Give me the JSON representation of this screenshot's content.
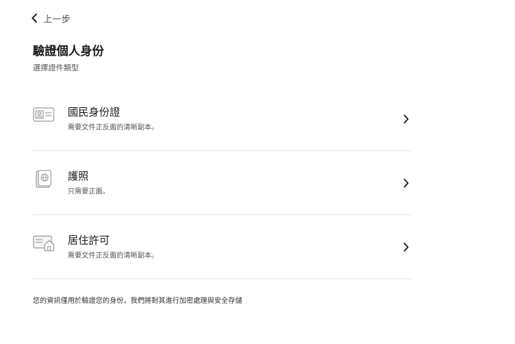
{
  "nav": {
    "back_label": "上一步",
    "back_icon": "chevron-left-icon"
  },
  "page": {
    "title": "驗證個人身份",
    "subtitle": "選擇證件類型"
  },
  "options": [
    {
      "title": "國民身份證",
      "description": "需要文件正反面的清晰副本。",
      "icon": "id-card-icon"
    },
    {
      "title": "護照",
      "description": "只需要正面。",
      "icon": "passport-icon"
    },
    {
      "title": "居住許可",
      "description": "需要文件正反面的清晰副本。",
      "icon": "residence-permit-icon"
    }
  ],
  "footer": {
    "text": "您的資訊僅用於驗證您的身份，我們將對其進行加密處理與安全存儲"
  },
  "colors": {
    "text_primary": "#1a1a1a",
    "text_secondary": "#555555",
    "icon_stroke": "#9a9a9a",
    "divider": "#e3e3e3"
  }
}
